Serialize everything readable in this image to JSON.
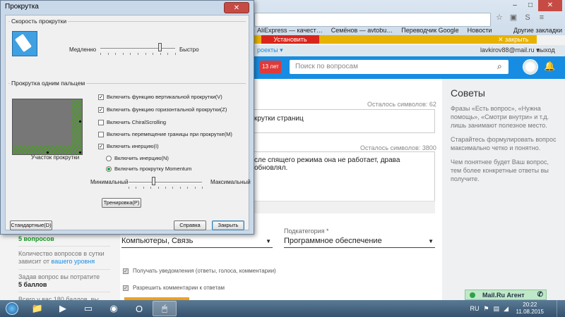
{
  "browser": {
    "bookmarks": [
      "AliExpress — качест…",
      "Семёнов — avtobu…",
      "Переводчик Google",
      "Новости"
    ],
    "bookmarks_other": "Другие закладки",
    "install_button": "Установить",
    "install_close": "✕ закрыть",
    "projects": "роекты ▾",
    "user_email": "lavkirov88@mail.ru ▾",
    "logout": "выход",
    "age_badge": "13 лет",
    "search_placeholder": "Поиск по вопросам"
  },
  "page": {
    "chars_left_question": "Осталось символов: 62",
    "question_text": "крутки страниц",
    "chars_left_description": "Осталось символов: 3800",
    "description_text": "сле спящего режима она не работает, драва обновлял.",
    "category_value": "Компьютеры, Связь",
    "subcategory_label": "Подкатегория *",
    "subcategory_value": "Программное обеспечение",
    "notify_label": "Получать уведомления (ответы, голоса, комментарии)",
    "allow_comments_label": "Разрешить комментарии к ответам"
  },
  "sidebar": {
    "questions_count": "5 вопросов",
    "questions_note": "Количество вопросов в сутки зависит от",
    "level_link": "вашего уровня",
    "cost_label": "Задав вопрос вы потратите",
    "cost_value": "5 баллов",
    "balance": "Всего у вас 180 баллов, вы"
  },
  "tips": {
    "title": "Советы",
    "p1": "Фразы «Есть вопрос», «Нужна помощь», «Смотри внутри» и т.д. лишь занимают полезное место.",
    "p2": "Старайтесь формулировать вопрос максимально четко и понятно.",
    "p3": "Чем понятнее будет Ваш вопрос, тем более конкретные ответы вы получите."
  },
  "agent": {
    "label": "Mail.Ru Агент"
  },
  "dialog": {
    "title": "Прокрутка",
    "close": "✕",
    "speed_group": "Скорость прокрутки",
    "slow": "Медленно",
    "fast": "Быстро",
    "speed_level": 0.8,
    "one_finger_group": "Прокрутка одним пальцем",
    "opt_vertical": "Включить функцию вертикальной прокрутки(V)",
    "opt_horizontal": "Включить функцию горизонтальной прокрутки(Z)",
    "opt_chiral": "Включить ChiralScrolling",
    "opt_border": "Включить перемещение границы при прокрутке(M)",
    "opt_inertia": "Включить инерцию(I)",
    "radio_inertia": "Включить инерцию(N)",
    "radio_momentum": "Включить прокрутку Momentum",
    "min": "Минимальный",
    "max": "Максимальный",
    "momentum_level": 0.35,
    "pad_caption": "Участок прокрутки",
    "training_button": "Тренировка(P)",
    "defaults_button": "Стандартные(D)",
    "help_button": "Справка",
    "close_button": "Закрыть"
  },
  "taskbar": {
    "time": "20:22",
    "date": "11.08.2015",
    "lang": "RU"
  }
}
